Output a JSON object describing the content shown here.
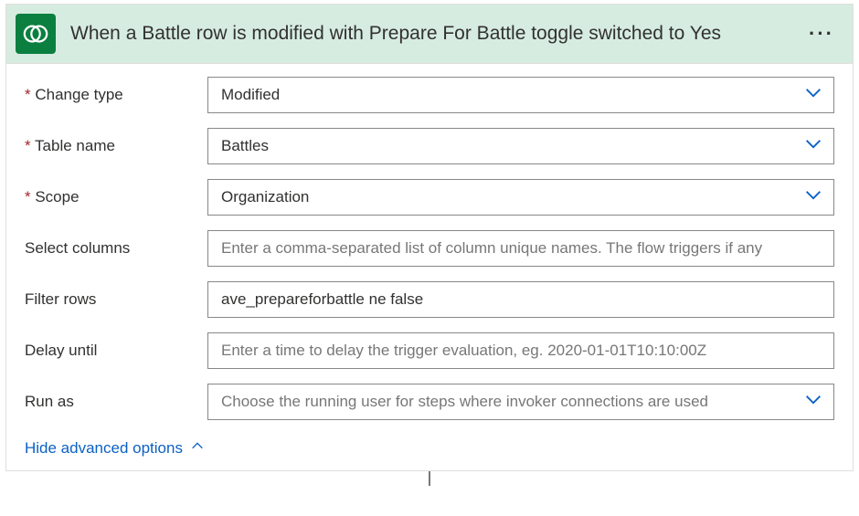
{
  "header": {
    "title": "When a Battle row is modified with Prepare For Battle toggle switched to Yes",
    "iconName": "dataverse-icon",
    "moreLabel": "···"
  },
  "fields": {
    "changeType": {
      "label": "Change type",
      "value": "Modified",
      "required": true,
      "type": "select",
      "placeholder": ""
    },
    "tableName": {
      "label": "Table name",
      "value": "Battles",
      "required": true,
      "type": "select",
      "placeholder": ""
    },
    "scope": {
      "label": "Scope",
      "value": "Organization",
      "required": true,
      "type": "select",
      "placeholder": ""
    },
    "selectColumns": {
      "label": "Select columns",
      "value": "",
      "required": false,
      "type": "text",
      "placeholder": "Enter a comma-separated list of column unique names. The flow triggers if any"
    },
    "filterRows": {
      "label": "Filter rows",
      "value": "ave_prepareforbattle ne false",
      "required": false,
      "type": "text",
      "placeholder": ""
    },
    "delayUntil": {
      "label": "Delay until",
      "value": "",
      "required": false,
      "type": "text",
      "placeholder": "Enter a time to delay the trigger evaluation, eg. 2020-01-01T10:10:00Z"
    },
    "runAs": {
      "label": "Run as",
      "value": "",
      "required": false,
      "type": "select",
      "placeholder": "Choose the running user for steps where invoker connections are used"
    }
  },
  "advancedToggle": {
    "label": "Hide advanced options"
  },
  "colors": {
    "headerBg": "#d6ece1",
    "brandBg": "#0a7f3f",
    "link": "#0b61c4",
    "chevron": "#0b61c4",
    "border": "#8a8886",
    "required": "#a4262c"
  }
}
